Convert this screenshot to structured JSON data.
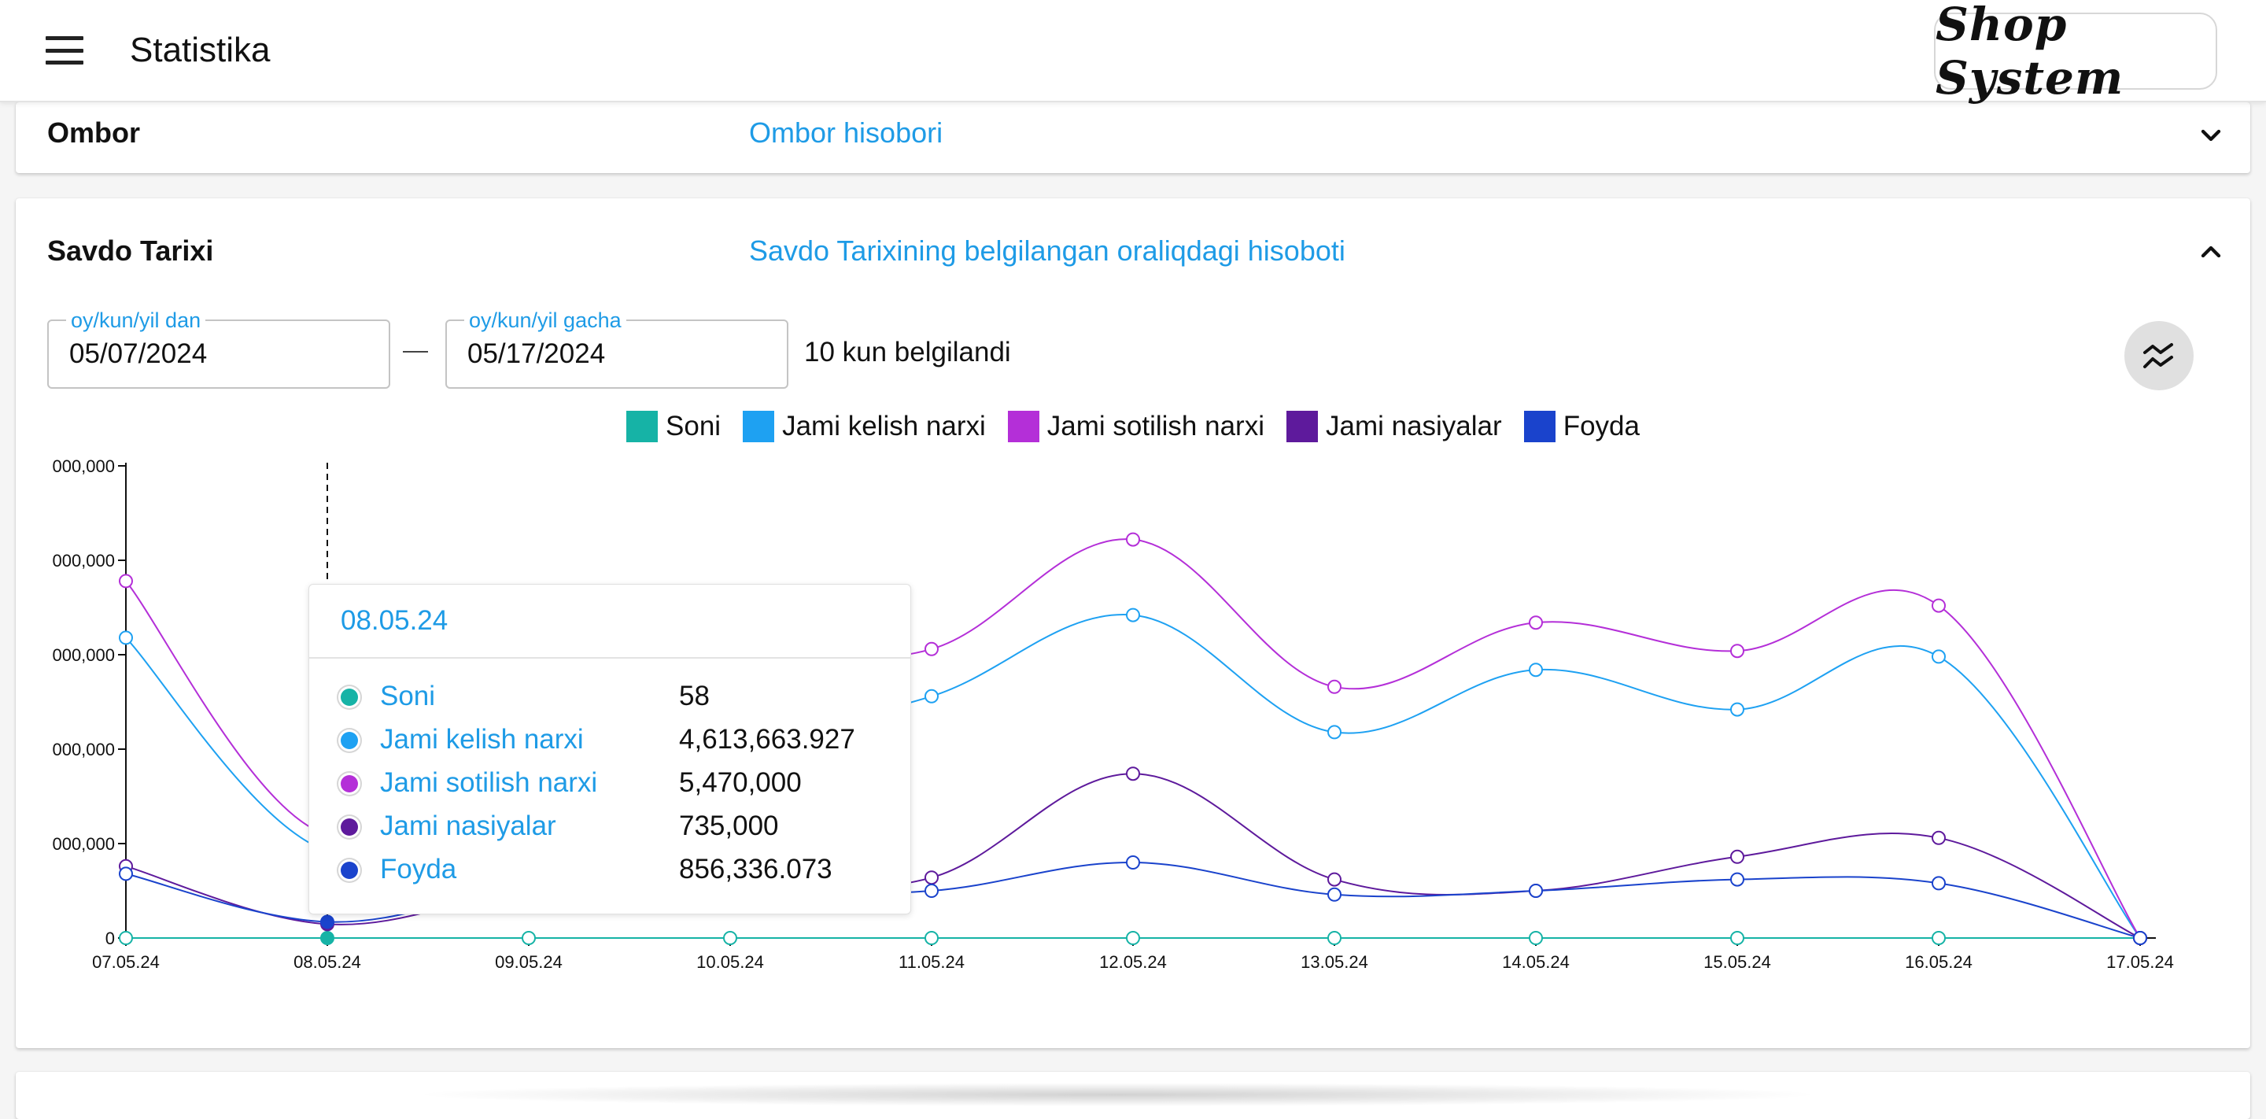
{
  "header": {
    "title": "Statistika",
    "logo_text": "Shop System"
  },
  "ombor": {
    "title": "Ombor",
    "subtitle": "Ombor hisobori"
  },
  "savdo": {
    "title": "Savdo Tarixi",
    "subtitle": "Savdo Tarixining belgilangan oraliqdagi hisoboti",
    "from_label": "oy/kun/yil dan",
    "from_value": "05/07/2024",
    "to_label": "oy/kun/yil gacha",
    "to_value": "05/17/2024",
    "days_text": "10 kun belgilandi"
  },
  "tooltip": {
    "date": "08.05.24",
    "rows": [
      {
        "name": "Soni",
        "value": "58",
        "color": "#16b3a6"
      },
      {
        "name": "Jami kelish narxi",
        "value": "4,613,663.927",
        "color": "#1ea1f2"
      },
      {
        "name": "Jami sotilish narxi",
        "value": "5,470,000",
        "color": "#b42fd8"
      },
      {
        "name": "Jami nasiyalar",
        "value": "735,000",
        "color": "#5e1a9c"
      },
      {
        "name": "Foyda",
        "value": "856,336.073",
        "color": "#1a43cc"
      }
    ]
  },
  "colors": {
    "accent": "#1e9be6"
  },
  "chart_data": {
    "type": "line",
    "x": [
      "07.05.24",
      "08.05.24",
      "09.05.24",
      "10.05.24",
      "11.05.24",
      "12.05.24",
      "13.05.24",
      "14.05.24",
      "15.05.24",
      "16.05.24",
      "17.05.24"
    ],
    "y_tick_labels": [
      "0",
      "000,000",
      "000,000",
      "000,000",
      "000,000",
      "000,000"
    ],
    "ylim": [
      0,
      25000000
    ],
    "y_ticks": [
      0,
      5000000,
      10000000,
      15000000,
      20000000,
      25000000
    ],
    "active_index": 1,
    "series": [
      {
        "name": "Soni",
        "color": "#16b3a6",
        "values": [
          10,
          58,
          12,
          10,
          12,
          15,
          10,
          12,
          12,
          12,
          0
        ]
      },
      {
        "name": "Jami kelish narxi",
        "color": "#1ea1f2",
        "values": [
          15.9,
          4.613663927,
          9.0,
          10.5,
          12.8,
          17.1,
          10.9,
          14.2,
          12.1,
          14.9,
          0
        ]
      },
      {
        "name": "Jami sotilish narxi",
        "color": "#b42fd8",
        "values": [
          18.9,
          5.47,
          13.0,
          15.0,
          15.3,
          21.1,
          13.3,
          16.7,
          15.2,
          17.6,
          0
        ]
      },
      {
        "name": "Jami nasiyalar",
        "color": "#5e1a9c",
        "values": [
          3.8,
          0.735,
          2.5,
          2.8,
          3.2,
          8.7,
          3.1,
          2.5,
          4.3,
          5.3,
          0
        ]
      },
      {
        "name": "Foyda",
        "color": "#1a43cc",
        "values": [
          3.4,
          0.856336073,
          2.6,
          2.4,
          2.5,
          4.0,
          2.3,
          2.5,
          3.1,
          2.9,
          0
        ]
      }
    ],
    "value_unit_multiplier_note": "values for the four money series are in millions",
    "grid": false,
    "legend": "top-center"
  }
}
